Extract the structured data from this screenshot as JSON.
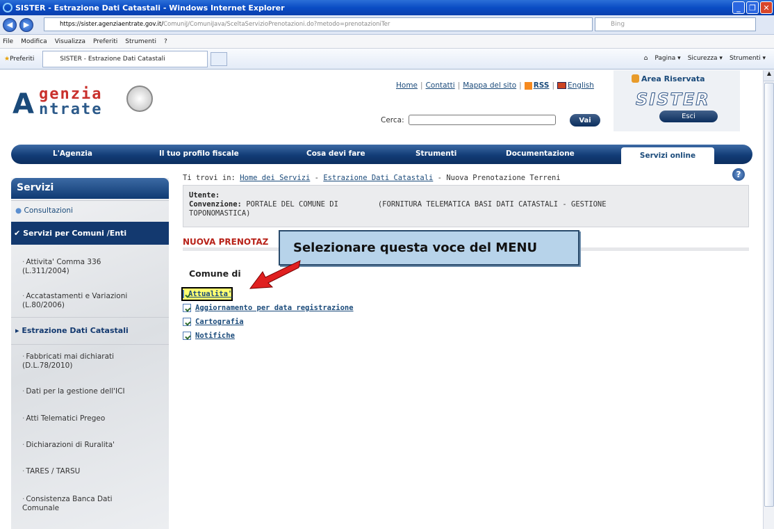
{
  "window": {
    "title": "SISTER - Estrazione Dati Catastali - Windows Internet Explorer"
  },
  "address": {
    "host": "https://sister.agenziaentrate.gov.it/",
    "path": "ComuniJ/ComuniJava/SceltaServizioPrenotazioni.do?metodo=prenotazioniTer",
    "search_placeholder": "Bing"
  },
  "menu": [
    "File",
    "Modifica",
    "Visualizza",
    "Preferiti",
    "Strumenti",
    "?"
  ],
  "favbar": {
    "favorites": "Preferiti",
    "tab": "SISTER - Estrazione Dati Catastali"
  },
  "commands": [
    "Pagina ▾",
    "Sicurezza ▾",
    "Strumenti ▾"
  ],
  "logo": {
    "line1": "genzia",
    "line2": "ntrate"
  },
  "toplinks": {
    "home": "Home",
    "contatti": "Contatti",
    "mappa": "Mappa del sito",
    "rss": "RSS",
    "english": "English"
  },
  "search": {
    "label": "Cerca:",
    "button": "Vai"
  },
  "reserved": {
    "title": "Area Riservata",
    "brand": "SISTER",
    "exit": "Esci"
  },
  "nav": [
    "L'Agenzia",
    "Il tuo profilo fiscale",
    "Cosa devi fare",
    "Strumenti",
    "Documentazione",
    "Servizi online"
  ],
  "sidebar": {
    "title": "Servizi",
    "consultazioni": "Consultazioni",
    "selected": "Servizi per Comuni /Enti",
    "items": [
      {
        "l1": "Attivita' Comma 336",
        "l2": "(L.311/2004)"
      },
      {
        "l1": "Accatastamenti e Variazioni",
        "l2": "(L.80/2006)"
      },
      {
        "l1": "Estrazione Dati Catastali",
        "l2": ""
      },
      {
        "l1": "Fabbricati mai dichiarati",
        "l2": "(D.L.78/2010)"
      },
      {
        "l1": "Dati per la gestione dell'ICI",
        "l2": ""
      },
      {
        "l1": "Atti Telematici Pregeo",
        "l2": ""
      },
      {
        "l1": "Dichiarazioni di Ruralita'",
        "l2": ""
      },
      {
        "l1": "TARES / TARSU",
        "l2": ""
      },
      {
        "l1": "Consistenza Banca Dati",
        "l2": "Comunale"
      }
    ]
  },
  "breadcrumb": {
    "prefix": "Ti trovi in:",
    "home": "Home dei Servizi",
    "estr": "Estrazione Dati Catastali",
    "current": "Nuova Prenotazione Terreni"
  },
  "user": {
    "utente_label": "Utente:",
    "conv_label": "Convenzione:",
    "conv_text": "PORTALE DEL COMUNE DI",
    "conv_rest": "(FORNITURA TELEMATICA BASI DATI CATASTALI - GESTIONE",
    "conv_line2": "TOPONOMASTICA)"
  },
  "section": {
    "title": "NUOVA PRENOTAZ"
  },
  "callout": "Selezionare questa  voce del MENU",
  "comune": "Comune di",
  "links": [
    "Attualita'",
    "Aggiornamento per data registrazione",
    "Cartografia",
    "Notifiche"
  ]
}
